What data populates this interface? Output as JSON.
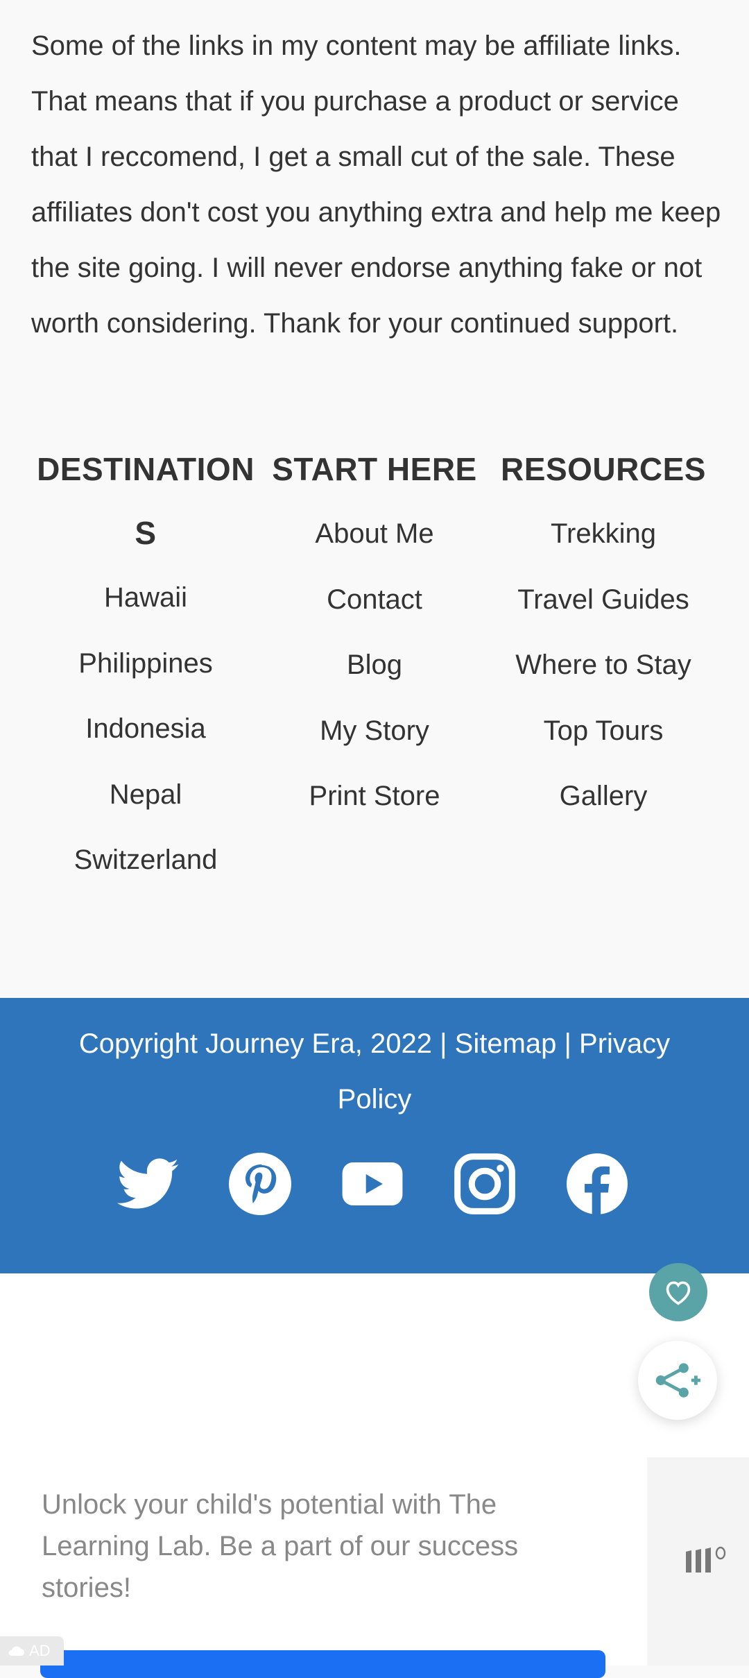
{
  "disclaimer": {
    "text": "Some of the links in my content may be affiliate links. That means that if you purchase a product or service that I reccomend, I get a small cut of the sale. These affiliates don't cost you anything extra and help me keep the site going. I will never endorse anything fake or not worth considering. Thank for your continued support."
  },
  "footer_columns": {
    "destinations": {
      "title": "DESTINATIONS",
      "items": [
        "Hawaii",
        "Philippines",
        "Indonesia",
        "Nepal",
        "Switzerland"
      ]
    },
    "start_here": {
      "title": "START HERE",
      "items": [
        "About Me",
        "Contact",
        "Blog",
        "My Story",
        "Print Store"
      ]
    },
    "resources": {
      "title": "RESOURCES",
      "items": [
        "Trekking",
        "Travel Guides",
        "Where to Stay",
        "Top Tours",
        "Gallery"
      ]
    }
  },
  "copyright": {
    "text": "Copyright Journey Era, 2022",
    "separator": "|",
    "sitemap": "Sitemap",
    "privacy": "Privacy Policy"
  },
  "social": [
    "twitter-icon",
    "pinterest-icon",
    "youtube-icon",
    "instagram-icon",
    "facebook-icon"
  ],
  "ad": {
    "text": "Unlock your child's potential with The Learning Lab. Be a part of our success stories!",
    "badge": "AD"
  },
  "colors": {
    "footer_blue": "#2e75bb",
    "heart_teal": "#5aa3a6",
    "ad_button_blue": "#1a6ff3"
  }
}
